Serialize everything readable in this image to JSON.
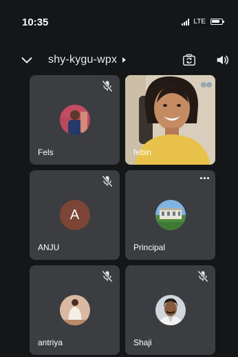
{
  "status_bar": {
    "time": "10:35",
    "network": "LTE"
  },
  "meeting": {
    "code": "shy-kygu-wpx"
  },
  "participants": [
    {
      "name": "Fels"
    },
    {
      "name": "febin"
    },
    {
      "name": "ANJU",
      "initial": "A"
    },
    {
      "name": "Principal"
    },
    {
      "name": "antriya"
    },
    {
      "name": "Shaji"
    }
  ],
  "icons": {
    "back": "chevron-down-icon",
    "switch_camera": "switch-camera-icon",
    "audio": "speaker-icon",
    "muted": "mic-off-icon",
    "options": "more-options-icon"
  },
  "colors": {
    "background": "#151618",
    "tile": "#3c3d40",
    "avatar_letter_bg": "#7d4535"
  }
}
